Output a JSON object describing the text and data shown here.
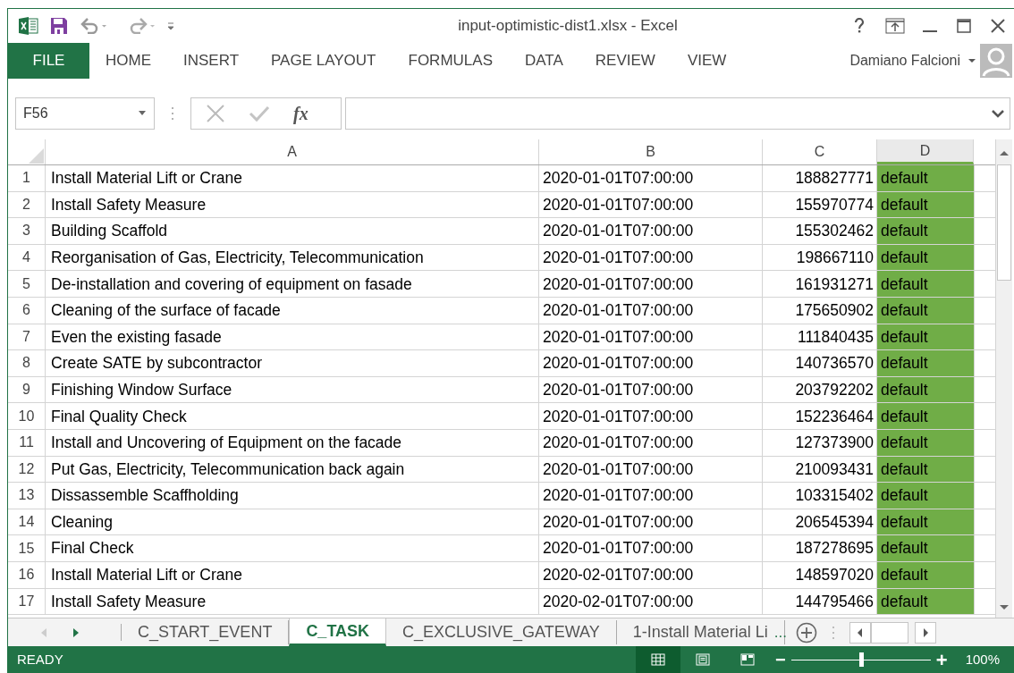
{
  "window": {
    "title": "input-optimistic-dist1.xlsx - Excel"
  },
  "ribbon_tabs": [
    {
      "label": "FILE",
      "kind": "file"
    },
    {
      "label": "HOME",
      "kind": "tab"
    },
    {
      "label": "INSERT",
      "kind": "tab"
    },
    {
      "label": "PAGE LAYOUT",
      "kind": "tab"
    },
    {
      "label": "FORMULAS",
      "kind": "tab"
    },
    {
      "label": "DATA",
      "kind": "tab"
    },
    {
      "label": "REVIEW",
      "kind": "tab"
    },
    {
      "label": "VIEW",
      "kind": "tab"
    }
  ],
  "user": {
    "name": "Damiano Falcioni"
  },
  "formula_bar": {
    "name_box": "F56",
    "fx": "fx"
  },
  "table": {
    "columns": [
      "A",
      "B",
      "C",
      "D"
    ],
    "rows": [
      {
        "n": "1",
        "a": "Install Material Lift or Crane",
        "b": "2020-01-01T07:00:00",
        "c": "188827771",
        "d": "default"
      },
      {
        "n": "2",
        "a": "Install Safety Measure",
        "b": "2020-01-01T07:00:00",
        "c": "155970774",
        "d": "default"
      },
      {
        "n": "3",
        "a": "Building Scaffold",
        "b": "2020-01-01T07:00:00",
        "c": "155302462",
        "d": "default"
      },
      {
        "n": "4",
        "a": "Reorganisation of Gas, Electricity, Telecommunication",
        "b": "2020-01-01T07:00:00",
        "c": "198667110",
        "d": "default"
      },
      {
        "n": "5",
        "a": "De-installation and covering of equipment on fasade",
        "b": "2020-01-01T07:00:00",
        "c": "161931271",
        "d": "default"
      },
      {
        "n": "6",
        "a": "Cleaning of the surface of facade",
        "b": "2020-01-01T07:00:00",
        "c": "175650902",
        "d": "default"
      },
      {
        "n": "7",
        "a": "Even the existing fasade",
        "b": "2020-01-01T07:00:00",
        "c": "111840435",
        "d": "default"
      },
      {
        "n": "8",
        "a": "Create SATE by subcontractor",
        "b": "2020-01-01T07:00:00",
        "c": "140736570",
        "d": "default"
      },
      {
        "n": "9",
        "a": "Finishing Window Surface",
        "b": "2020-01-01T07:00:00",
        "c": "203792202",
        "d": "default"
      },
      {
        "n": "10",
        "a": "Final Quality Check",
        "b": "2020-01-01T07:00:00",
        "c": "152236464",
        "d": "default"
      },
      {
        "n": "11",
        "a": "Install and Uncovering of Equipment on the facade",
        "b": "2020-01-01T07:00:00",
        "c": "127373900",
        "d": "default"
      },
      {
        "n": "12",
        "a": "Put Gas, Electricity, Telecommunication back again",
        "b": "2020-01-01T07:00:00",
        "c": "210093431",
        "d": "default"
      },
      {
        "n": "13",
        "a": "Dissassemble Scaffholding",
        "b": "2020-01-01T07:00:00",
        "c": "103315402",
        "d": "default"
      },
      {
        "n": "14",
        "a": "Cleaning",
        "b": "2020-01-01T07:00:00",
        "c": "206545394",
        "d": "default"
      },
      {
        "n": "15",
        "a": "Final Check",
        "b": "2020-01-01T07:00:00",
        "c": "187278695",
        "d": "default"
      },
      {
        "n": "16",
        "a": "Install Material Lift or Crane",
        "b": "2020-02-01T07:00:00",
        "c": "148597020",
        "d": "default"
      },
      {
        "n": "17",
        "a": "Install Safety Measure",
        "b": "2020-02-01T07:00:00",
        "c": "144795466",
        "d": "default"
      }
    ]
  },
  "sheet_tabs": [
    {
      "label": "C_START_EVENT",
      "selected": false
    },
    {
      "label": "C_TASK",
      "selected": true
    },
    {
      "label": "C_EXCLUSIVE_GATEWAY",
      "selected": false
    },
    {
      "label": "1-Install Material Li",
      "selected": false
    }
  ],
  "sheet_more": "...",
  "status_bar": {
    "status": "READY",
    "views": [
      {
        "kind": "normal",
        "selected": true
      },
      {
        "kind": "page-layout",
        "selected": false
      },
      {
        "kind": "page-break",
        "selected": false
      }
    ],
    "zoom_minus": "−",
    "zoom_plus": "+",
    "zoom": {
      "level": 0.5
    },
    "zoom_text": "100%"
  }
}
